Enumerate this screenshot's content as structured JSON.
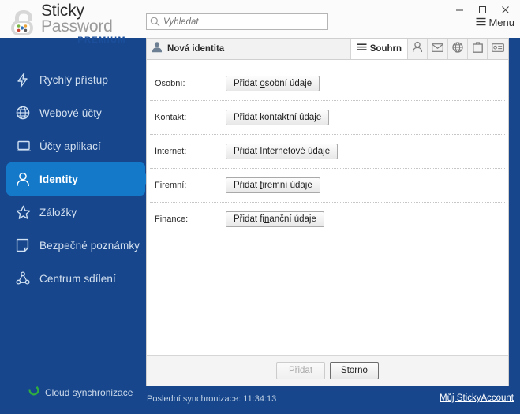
{
  "app": {
    "brand_line1": "Sticky",
    "brand_line2": "Password",
    "brand_edition": "PREMIUM",
    "accent_blue": "#17468c",
    "active_blue": "#1479c9"
  },
  "titlebar": {
    "minimize_label": "–",
    "maximize_label": "☐",
    "close_label": "✕",
    "menu_label": "Menu"
  },
  "search": {
    "placeholder": "Vyhledat",
    "value": ""
  },
  "sidebar": {
    "items": [
      {
        "label": "Rychlý přístup",
        "icon": "bolt-icon",
        "active": false
      },
      {
        "label": "Webové účty",
        "icon": "globe-icon",
        "active": false
      },
      {
        "label": "Účty aplikací",
        "icon": "laptop-icon",
        "active": false
      },
      {
        "label": "Identity",
        "icon": "person-icon",
        "active": true
      },
      {
        "label": "Záložky",
        "icon": "star-icon",
        "active": false
      },
      {
        "label": "Bezpečné poznámky",
        "icon": "note-icon",
        "active": false
      },
      {
        "label": "Centrum sdílení",
        "icon": "share-icon",
        "active": false
      }
    ],
    "cloud_sync_label": "Cloud synchronizace"
  },
  "panel": {
    "title": "Nová identita",
    "title_icon": "user-avatar-icon",
    "tabs": [
      {
        "label": "Souhrn",
        "icon": "list-icon",
        "active": true
      },
      {
        "label": "",
        "icon": "person-icon",
        "active": false
      },
      {
        "label": "",
        "icon": "envelope-icon",
        "active": false
      },
      {
        "label": "",
        "icon": "globe-icon",
        "active": false
      },
      {
        "label": "",
        "icon": "briefcase-icon",
        "active": false
      },
      {
        "label": "",
        "icon": "id-card-icon",
        "active": false
      }
    ],
    "rows": [
      {
        "label": "Osobní:",
        "button_pre": "Přidat ",
        "button_key": "o",
        "button_post": "sobní údaje"
      },
      {
        "label": "Kontakt:",
        "button_pre": "Přidat ",
        "button_key": "k",
        "button_post": "ontaktní údaje"
      },
      {
        "label": "Internet:",
        "button_pre": "Přidat ",
        "button_key": "I",
        "button_post": "nternetové údaje"
      },
      {
        "label": "Firemní:",
        "button_pre": "Přidat ",
        "button_key": "f",
        "button_post": "iremní údaje"
      },
      {
        "label": "Finance:",
        "button_pre": "Přidat fi",
        "button_key": "n",
        "button_post": "anční údaje"
      }
    ],
    "footer": {
      "add_label": "Přidat",
      "cancel_label": "Storno"
    }
  },
  "statusbar": {
    "sync_text": "Poslední synchronizace: 11:34:13",
    "account_link": "Můj StickyAccount"
  }
}
